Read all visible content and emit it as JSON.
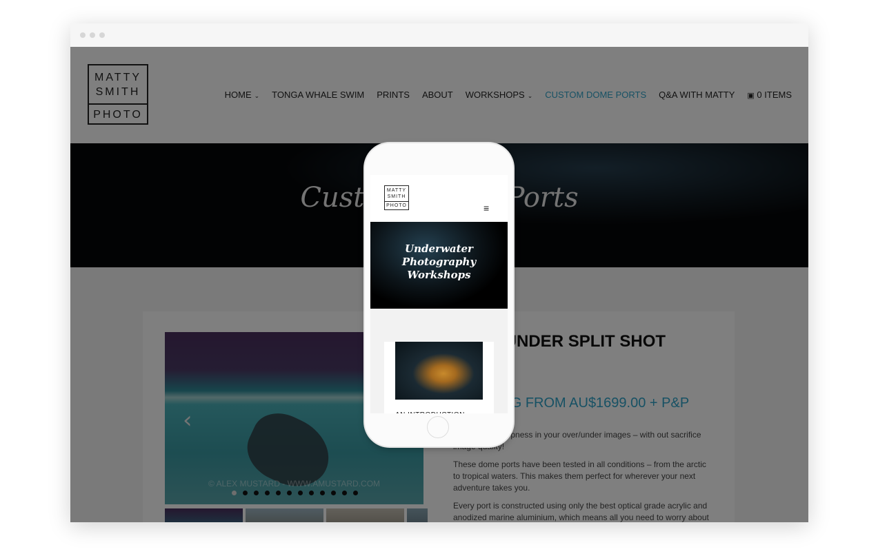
{
  "browser": {
    "window_controls": [
      "close",
      "minimize",
      "maximize"
    ]
  },
  "site": {
    "logo": {
      "line1": "MATTY",
      "line2": "SMITH",
      "line3": "PHOTO"
    },
    "nav": [
      {
        "label": "HOME",
        "has_dropdown": true
      },
      {
        "label": "TONGA WHALE SWIM",
        "has_dropdown": false
      },
      {
        "label": "PRINTS",
        "has_dropdown": false
      },
      {
        "label": "ABOUT",
        "has_dropdown": false
      },
      {
        "label": "WORKSHOPS",
        "has_dropdown": true
      },
      {
        "label": "CUSTOM DOME PORTS",
        "has_dropdown": false,
        "active": true
      },
      {
        "label": "Q&A WITH MATTY",
        "has_dropdown": false
      },
      {
        "label": "0 ITEMS",
        "icon": "cart-icon"
      }
    ],
    "chevron": "⌄",
    "cart_glyph": "🛒",
    "hero_title": "Custom Dome Ports",
    "slider": {
      "prev_arrow": "‹",
      "watermark": "© ALEX MUSTARD - WWW.AMUSTARD.COM",
      "dot_count": 12,
      "active_dot": 1
    },
    "product": {
      "title": "OVER UNDER SPLIT SHOT DOME",
      "price": "STARTING FROM AU$1699.00 + P&P",
      "paragraphs": [
        "Bring back sharpness in your over/under images – with out sacrifice image quality!",
        "These dome ports have been tested in all conditions – from the arctic to tropical waters.  This makes them perfect for wherever your next adventure takes you.",
        "Every port is constructed using only the best optical grade acrylic and anodized marine aluminium, which means all you need to worry about is being in the water to get the shot."
      ]
    },
    "accent_color": "#2ea3c9"
  },
  "phone": {
    "menu_icon": "≡",
    "hero_text": [
      "Underwater",
      "Photography",
      "Workshops"
    ],
    "card_caption": "AN INTRODUCTION"
  }
}
